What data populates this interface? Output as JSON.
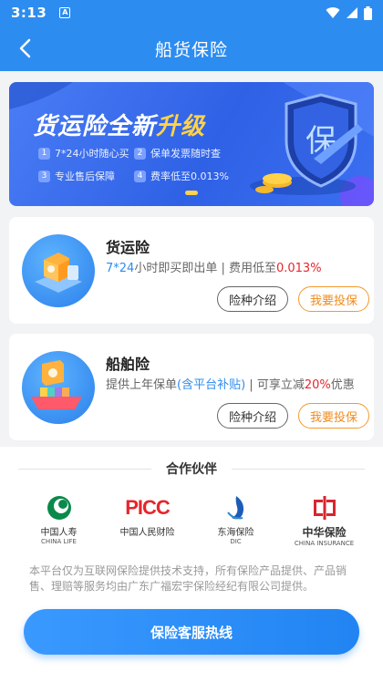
{
  "status_bar": {
    "time": "3:13",
    "notification_glyph": "A"
  },
  "nav": {
    "title": "船货保险"
  },
  "banner": {
    "headline_main": "货运险全新",
    "headline_highlight": "升级",
    "features": [
      {
        "num": "1",
        "text": "7*24小时随心买"
      },
      {
        "num": "2",
        "text": "保单发票随时查"
      },
      {
        "num": "3",
        "text": "专业售后保障"
      },
      {
        "num": "4",
        "text": "费率低至0.013%"
      }
    ],
    "shield_text": "保"
  },
  "products": [
    {
      "name": "货运险",
      "desc_part1": "7*24",
      "desc_part2": "小时即买即出单 | 费用低至",
      "desc_part3": "0.013%",
      "intro_label": "险种介绍",
      "buy_label": "我要投保"
    },
    {
      "name": "船舶险",
      "desc_part1": "提供上年保单",
      "desc_part2": "(含平台补贴)",
      "desc_part3": " | 可享立减",
      "desc_part4": "20%",
      "desc_part5": "优惠",
      "intro_label": "险种介绍",
      "buy_label": "我要投保"
    }
  ],
  "partners": {
    "title": "合作伙伴",
    "logos": [
      {
        "cn": "中国人寿",
        "en": "CHINA LIFE"
      },
      {
        "mark": "PICC",
        "cn": "中国人民财险"
      },
      {
        "cn": "东海保险",
        "en": "DIC"
      },
      {
        "cn": "中华保险",
        "en": "CHINA INSURANCE"
      }
    ]
  },
  "disclaimer": "本平台仅为互联网保险提供技术支持，所有保险产品提供、产品销售、理赔等服务均由广东广福宏宇保险经纪有限公司提供。",
  "hotline_label": "保险客服热线",
  "colors": {
    "primary": "#2d8cf0",
    "accent_red": "#e5262d",
    "accent_orange": "#f08b1c",
    "banner_highlight": "#ffd24a"
  }
}
